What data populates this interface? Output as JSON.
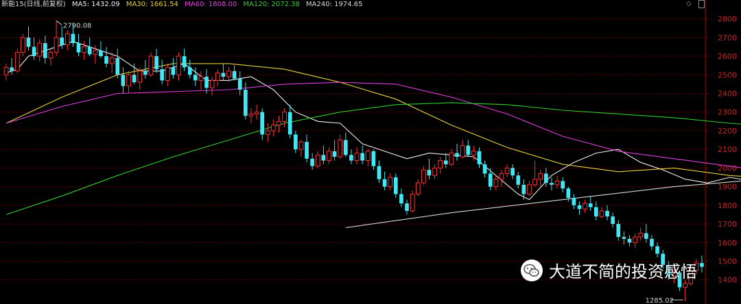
{
  "header": {
    "title": "新能15(日线,前复权)",
    "ma_items": [
      {
        "label": "MA5: 1432.09",
        "color": "#f2f2f2"
      },
      {
        "label": "MA30: 1661.54",
        "color": "#e8d43a"
      },
      {
        "label": "MA60: 1808.00",
        "color": "#e040e0"
      },
      {
        "label": "MA120: 2072.38",
        "color": "#2fd12f"
      },
      {
        "label": "MA240: 1974.65",
        "color": "#d9d9d9"
      }
    ]
  },
  "controls": {
    "diamond_icon": "diamond-icon",
    "scroll_icon": "scroll-icon"
  },
  "annotations": {
    "high": "2790.08",
    "low": "1285.02"
  },
  "watermark": {
    "text": "大道不简的投资感悟",
    "icon": "wechat-icon"
  },
  "colors": {
    "up": "#ff3333",
    "down": "#43e6f2",
    "axis": "#b00000",
    "grid": "#7a0000"
  },
  "chart_data": {
    "type": "candlestick",
    "ylim": [
      1285,
      2850
    ],
    "y_ticks": [
      1400,
      1500,
      1600,
      1700,
      1800,
      1900,
      2000,
      2100,
      2200,
      2300,
      2400,
      2500,
      2600,
      2700,
      2800
    ],
    "ohlc": [
      [
        2500,
        2560,
        2470,
        2540
      ],
      [
        2540,
        2590,
        2500,
        2520
      ],
      [
        2520,
        2640,
        2510,
        2620
      ],
      [
        2620,
        2720,
        2600,
        2700
      ],
      [
        2700,
        2760,
        2630,
        2650
      ],
      [
        2650,
        2700,
        2580,
        2600
      ],
      [
        2600,
        2690,
        2570,
        2670
      ],
      [
        2670,
        2710,
        2560,
        2590
      ],
      [
        2590,
        2640,
        2550,
        2620
      ],
      [
        2620,
        2790,
        2600,
        2700
      ],
      [
        2700,
        2760,
        2640,
        2660
      ],
      [
        2660,
        2740,
        2630,
        2720
      ],
      [
        2720,
        2780,
        2650,
        2670
      ],
      [
        2670,
        2720,
        2600,
        2620
      ],
      [
        2620,
        2680,
        2580,
        2650
      ],
      [
        2650,
        2700,
        2600,
        2610
      ],
      [
        2610,
        2660,
        2560,
        2630
      ],
      [
        2630,
        2680,
        2590,
        2600
      ],
      [
        2600,
        2650,
        2540,
        2560
      ],
      [
        2560,
        2620,
        2510,
        2590
      ],
      [
        2590,
        2640,
        2480,
        2500
      ],
      [
        2500,
        2540,
        2400,
        2440
      ],
      [
        2440,
        2520,
        2400,
        2500
      ],
      [
        2500,
        2560,
        2450,
        2460
      ],
      [
        2460,
        2540,
        2420,
        2520
      ],
      [
        2520,
        2580,
        2480,
        2500
      ],
      [
        2500,
        2620,
        2490,
        2600
      ],
      [
        2600,
        2640,
        2510,
        2530
      ],
      [
        2530,
        2580,
        2450,
        2470
      ],
      [
        2470,
        2560,
        2440,
        2540
      ],
      [
        2540,
        2590,
        2480,
        2500
      ],
      [
        2500,
        2620,
        2470,
        2600
      ],
      [
        2600,
        2640,
        2520,
        2540
      ],
      [
        2540,
        2580,
        2480,
        2500
      ],
      [
        2500,
        2540,
        2440,
        2470
      ],
      [
        2470,
        2520,
        2420,
        2490
      ],
      [
        2490,
        2530,
        2400,
        2430
      ],
      [
        2430,
        2490,
        2390,
        2470
      ],
      [
        2470,
        2530,
        2440,
        2510
      ],
      [
        2510,
        2560,
        2470,
        2490
      ],
      [
        2490,
        2540,
        2460,
        2520
      ],
      [
        2520,
        2550,
        2470,
        2480
      ],
      [
        2480,
        2520,
        2390,
        2420
      ],
      [
        2420,
        2460,
        2260,
        2280
      ],
      [
        2280,
        2320,
        2240,
        2290
      ],
      [
        2290,
        2340,
        2260,
        2300
      ],
      [
        2300,
        2320,
        2150,
        2180
      ],
      [
        2180,
        2240,
        2140,
        2200
      ],
      [
        2200,
        2260,
        2170,
        2230
      ],
      [
        2230,
        2280,
        2190,
        2250
      ],
      [
        2250,
        2320,
        2220,
        2300
      ],
      [
        2300,
        2340,
        2160,
        2180
      ],
      [
        2180,
        2200,
        2080,
        2100
      ],
      [
        2100,
        2150,
        2060,
        2140
      ],
      [
        2140,
        2180,
        2030,
        2050
      ],
      [
        2050,
        2080,
        1990,
        2010
      ],
      [
        2010,
        2090,
        2000,
        2070
      ],
      [
        2070,
        2120,
        2020,
        2040
      ],
      [
        2040,
        2110,
        2020,
        2090
      ],
      [
        2090,
        2150,
        2040,
        2060
      ],
      [
        2060,
        2180,
        2050,
        2150
      ],
      [
        2150,
        2190,
        2060,
        2070
      ],
      [
        2070,
        2100,
        2020,
        2040
      ],
      [
        2040,
        2110,
        2020,
        2080
      ],
      [
        2080,
        2120,
        2020,
        2040
      ],
      [
        2040,
        2100,
        2010,
        2090
      ],
      [
        2090,
        2100,
        1990,
        2010
      ],
      [
        2010,
        2040,
        1920,
        1940
      ],
      [
        1940,
        1980,
        1880,
        1900
      ],
      [
        1900,
        1970,
        1880,
        1950
      ],
      [
        1950,
        1970,
        1840,
        1860
      ],
      [
        1860,
        1890,
        1790,
        1810
      ],
      [
        1810,
        1830,
        1750,
        1770
      ],
      [
        1770,
        1880,
        1760,
        1860
      ],
      [
        1860,
        1940,
        1850,
        1920
      ],
      [
        1920,
        2010,
        1910,
        1990
      ],
      [
        1990,
        2050,
        1940,
        1960
      ],
      [
        1960,
        2020,
        1940,
        2000
      ],
      [
        2000,
        2060,
        1970,
        2040
      ],
      [
        2040,
        2080,
        2000,
        2020
      ],
      [
        2020,
        2100,
        2010,
        2080
      ],
      [
        2080,
        2130,
        2040,
        2060
      ],
      [
        2060,
        2150,
        2050,
        2120
      ],
      [
        2120,
        2150,
        2060,
        2070
      ],
      [
        2070,
        2120,
        2040,
        2090
      ],
      [
        2090,
        2110,
        2000,
        2020
      ],
      [
        2020,
        2040,
        1950,
        1970
      ],
      [
        1970,
        2000,
        1880,
        1900
      ],
      [
        1900,
        1960,
        1880,
        1940
      ],
      [
        1940,
        1990,
        1900,
        1970
      ],
      [
        1970,
        2020,
        1950,
        2000
      ],
      [
        2000,
        2020,
        1940,
        1960
      ],
      [
        1960,
        1980,
        1890,
        1910
      ],
      [
        1910,
        1940,
        1830,
        1860
      ],
      [
        1860,
        1930,
        1850,
        1910
      ],
      [
        1910,
        2040,
        1900,
        1940
      ],
      [
        1940,
        1990,
        1900,
        1970
      ],
      [
        1970,
        2000,
        1900,
        1920
      ],
      [
        1920,
        1950,
        1880,
        1910
      ],
      [
        1910,
        1960,
        1890,
        1930
      ],
      [
        1930,
        1950,
        1870,
        1890
      ],
      [
        1890,
        1900,
        1820,
        1840
      ],
      [
        1840,
        1860,
        1780,
        1800
      ],
      [
        1800,
        1820,
        1750,
        1780
      ],
      [
        1780,
        1830,
        1760,
        1810
      ],
      [
        1810,
        1850,
        1770,
        1790
      ],
      [
        1790,
        1820,
        1720,
        1740
      ],
      [
        1740,
        1790,
        1730,
        1770
      ],
      [
        1770,
        1800,
        1720,
        1740
      ],
      [
        1740,
        1760,
        1680,
        1700
      ],
      [
        1700,
        1720,
        1610,
        1630
      ],
      [
        1630,
        1660,
        1590,
        1620
      ],
      [
        1620,
        1640,
        1580,
        1600
      ],
      [
        1600,
        1650,
        1570,
        1630
      ],
      [
        1630,
        1680,
        1610,
        1650
      ],
      [
        1650,
        1700,
        1600,
        1620
      ],
      [
        1620,
        1640,
        1560,
        1580
      ],
      [
        1580,
        1600,
        1520,
        1540
      ],
      [
        1540,
        1560,
        1460,
        1480
      ],
      [
        1480,
        1500,
        1400,
        1420
      ],
      [
        1420,
        1460,
        1380,
        1440
      ],
      [
        1440,
        1450,
        1340,
        1360
      ],
      [
        1360,
        1400,
        1285,
        1380
      ],
      [
        1380,
        1460,
        1370,
        1450
      ],
      [
        1450,
        1510,
        1430,
        1490
      ],
      [
        1490,
        1530,
        1440,
        1470
      ]
    ],
    "ma_lines": [
      {
        "name": "MA5",
        "color": "#f2f2f2",
        "points": [
          [
            0,
            2510
          ],
          [
            2,
            2530
          ],
          [
            4,
            2600
          ],
          [
            8,
            2640
          ],
          [
            12,
            2680
          ],
          [
            16,
            2640
          ],
          [
            20,
            2600
          ],
          [
            24,
            2520
          ],
          [
            28,
            2520
          ],
          [
            32,
            2560
          ],
          [
            36,
            2470
          ],
          [
            40,
            2470
          ],
          [
            44,
            2490
          ],
          [
            48,
            2420
          ],
          [
            52,
            2300
          ],
          [
            56,
            2250
          ],
          [
            60,
            2240
          ],
          [
            64,
            2130
          ],
          [
            68,
            2090
          ],
          [
            72,
            2050
          ],
          [
            76,
            2080
          ],
          [
            80,
            2070
          ],
          [
            84,
            2060
          ],
          [
            88,
            1960
          ],
          [
            92,
            1860
          ],
          [
            94,
            1830
          ],
          [
            98,
            1960
          ],
          [
            102,
            2030
          ],
          [
            106,
            2080
          ],
          [
            110,
            2100
          ],
          [
            114,
            2030
          ],
          [
            118,
            1990
          ],
          [
            122,
            1940
          ],
          [
            126,
            1920
          ],
          [
            130,
            1950
          ],
          [
            134,
            1930
          ],
          [
            138,
            1880
          ],
          [
            142,
            1800
          ],
          [
            146,
            1770
          ],
          [
            150,
            1710
          ],
          [
            154,
            1630
          ],
          [
            158,
            1610
          ],
          [
            162,
            1620
          ],
          [
            166,
            1570
          ],
          [
            170,
            1480
          ],
          [
            174,
            1430
          ],
          [
            177,
            1440
          ]
        ]
      },
      {
        "name": "MA30",
        "color": "#e8d43a",
        "points": [
          [
            0,
            2240
          ],
          [
            10,
            2380
          ],
          [
            20,
            2500
          ],
          [
            30,
            2560
          ],
          [
            40,
            2560
          ],
          [
            50,
            2530
          ],
          [
            60,
            2460
          ],
          [
            70,
            2370
          ],
          [
            80,
            2230
          ],
          [
            90,
            2110
          ],
          [
            100,
            2020
          ],
          [
            110,
            1980
          ],
          [
            120,
            2000
          ],
          [
            130,
            1960
          ],
          [
            140,
            1940
          ],
          [
            150,
            1870
          ],
          [
            160,
            1790
          ],
          [
            170,
            1680
          ],
          [
            177,
            1661
          ]
        ]
      },
      {
        "name": "MA60",
        "color": "#e040e0",
        "points": [
          [
            0,
            2240
          ],
          [
            10,
            2330
          ],
          [
            20,
            2400
          ],
          [
            30,
            2410
          ],
          [
            40,
            2420
          ],
          [
            50,
            2450
          ],
          [
            60,
            2460
          ],
          [
            70,
            2450
          ],
          [
            80,
            2380
          ],
          [
            90,
            2290
          ],
          [
            100,
            2170
          ],
          [
            110,
            2090
          ],
          [
            120,
            2050
          ],
          [
            130,
            2010
          ],
          [
            140,
            1970
          ],
          [
            150,
            1940
          ],
          [
            160,
            1910
          ],
          [
            170,
            1860
          ],
          [
            177,
            1808
          ]
        ]
      },
      {
        "name": "MA120",
        "color": "#2fd12f",
        "points": [
          [
            0,
            1750
          ],
          [
            10,
            1850
          ],
          [
            20,
            1960
          ],
          [
            30,
            2060
          ],
          [
            40,
            2150
          ],
          [
            50,
            2240
          ],
          [
            60,
            2300
          ],
          [
            70,
            2340
          ],
          [
            80,
            2350
          ],
          [
            90,
            2340
          ],
          [
            100,
            2310
          ],
          [
            110,
            2290
          ],
          [
            120,
            2270
          ],
          [
            130,
            2240
          ],
          [
            140,
            2220
          ],
          [
            150,
            2210
          ],
          [
            160,
            2180
          ],
          [
            170,
            2140
          ],
          [
            177,
            2080
          ]
        ]
      },
      {
        "name": "MA240",
        "color": "#d9d9d9",
        "points": [
          [
            61,
            1680
          ],
          [
            80,
            1760
          ],
          [
            100,
            1830
          ],
          [
            120,
            1900
          ],
          [
            140,
            1950
          ],
          [
            160,
            1970
          ],
          [
            177,
            1980
          ]
        ]
      }
    ]
  }
}
